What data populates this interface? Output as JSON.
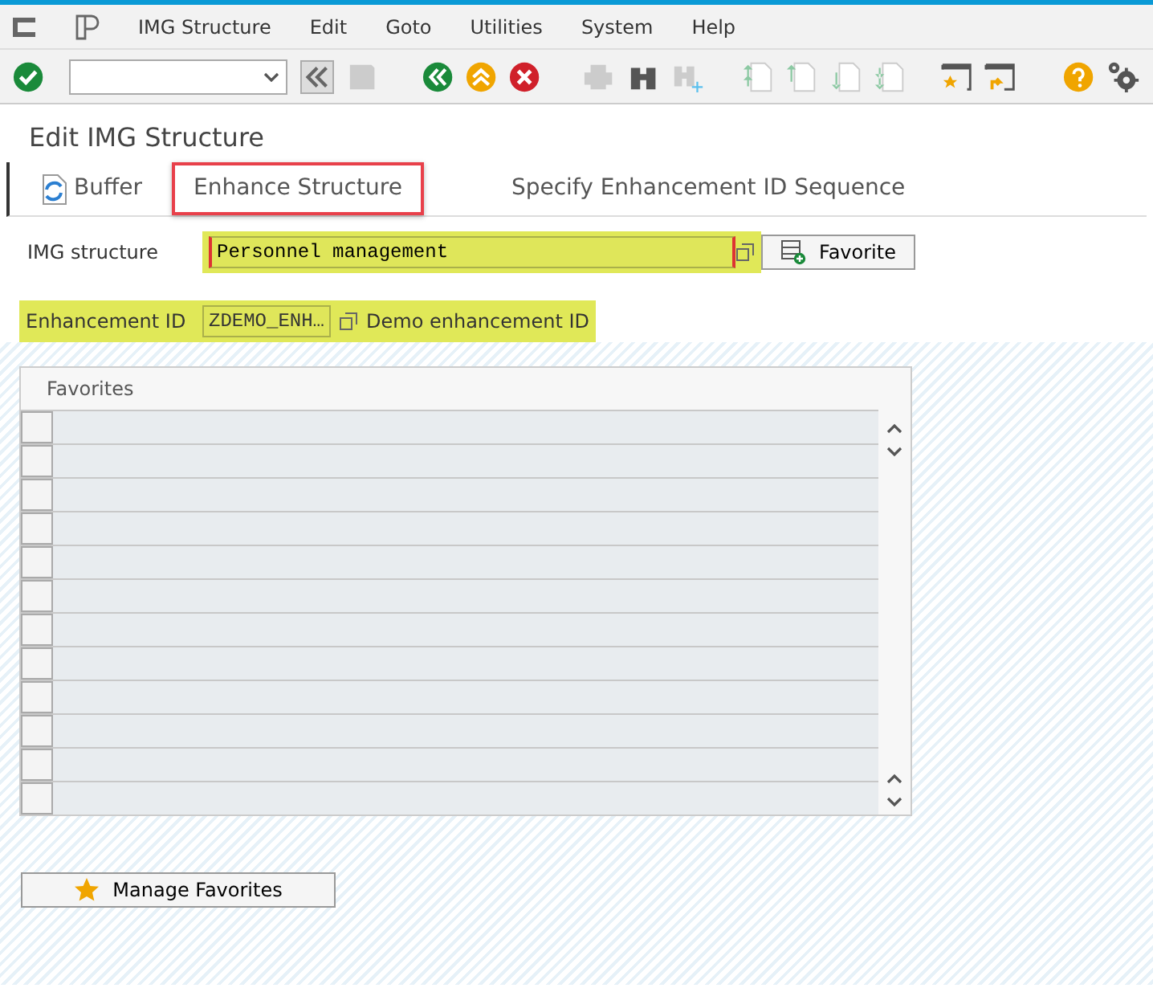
{
  "menu": [
    "IMG Structure",
    "Edit",
    "Goto",
    "Utilities",
    "System",
    "Help"
  ],
  "screen_title": "Edit IMG Structure",
  "app_toolbar": [
    {
      "label": "Buffer",
      "kind": "icon",
      "highlighted": false
    },
    {
      "label": "Enhance Structure",
      "kind": "plain",
      "highlighted": true
    },
    {
      "label": "Specify Enhancement ID Sequence",
      "kind": "plain",
      "highlighted": false
    }
  ],
  "img_structure": {
    "label": "IMG structure",
    "value": "Personnel management",
    "highlighted": true,
    "button": "Favorite"
  },
  "enhancement": {
    "label": "Enhancement ID",
    "value": "ZDEMO_ENH…",
    "description": "Demo enhancement ID",
    "highlighted": true
  },
  "favorites": {
    "title": "Favorites",
    "rows": [
      {
        "selected": false
      },
      {
        "selected": false
      },
      {
        "selected": false
      },
      {
        "selected": false
      },
      {
        "selected": false
      },
      {
        "selected": false
      },
      {
        "selected": false
      },
      {
        "selected": false
      },
      {
        "selected": false
      },
      {
        "selected": false
      },
      {
        "selected": false
      },
      {
        "selected": false
      }
    ]
  },
  "manage_button": "Manage Favorites"
}
